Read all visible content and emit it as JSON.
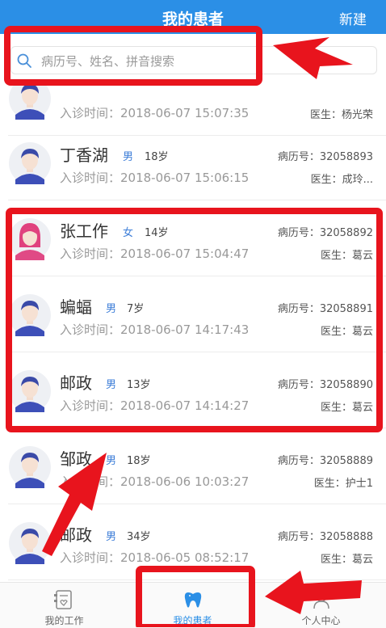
{
  "header": {
    "title": "我的患者",
    "new_label": "新建"
  },
  "search": {
    "placeholder": "病历号、姓名、拼音搜索"
  },
  "patients": [
    {
      "name": "",
      "gender": "",
      "age": "",
      "visit": "入诊时间：2018-06-07 15:07:35",
      "record": "",
      "doctor": "医生：杨光荣",
      "avatar": "male"
    },
    {
      "name": "丁香湖",
      "gender": "男",
      "age": "18岁",
      "visit": "入诊时间：2018-06-07 15:06:15",
      "record": "病历号：32058893",
      "doctor": "医生：成玲...",
      "avatar": "male"
    },
    {
      "name": "张工作",
      "gender": "女",
      "age": "14岁",
      "visit": "入诊时间：2018-06-07 15:04:47",
      "record": "病历号：32058892",
      "doctor": "医生：葛云",
      "avatar": "female"
    },
    {
      "name": "蝙蝠",
      "gender": "男",
      "age": "7岁",
      "visit": "入诊时间：2018-06-07 14:17:43",
      "record": "病历号：32058891",
      "doctor": "医生：葛云",
      "avatar": "male"
    },
    {
      "name": "邮政",
      "gender": "男",
      "age": "13岁",
      "visit": "入诊时间：2018-06-07 14:14:27",
      "record": "病历号：32058890",
      "doctor": "医生：葛云",
      "avatar": "male"
    },
    {
      "name": "邹政",
      "gender": "男",
      "age": "18岁",
      "visit": "入诊时间：2018-06-06 10:03:27",
      "record": "病历号：32058889",
      "doctor": "医生：护士1",
      "avatar": "male"
    },
    {
      "name": "邮政",
      "gender": "男",
      "age": "34岁",
      "visit": "入诊时间：2018-06-05 08:52:17",
      "record": "病历号：32058888",
      "doctor": "医生：葛云",
      "avatar": "male"
    }
  ],
  "tabs": [
    {
      "label": "我的工作",
      "icon": "work-icon",
      "active": false
    },
    {
      "label": "我的患者",
      "icon": "patient-icon",
      "active": true
    },
    {
      "label": "个人中心",
      "icon": "profile-icon",
      "active": false
    }
  ],
  "colors": {
    "primary": "#2b8fe6",
    "annotation": "#e8141d",
    "gender": "#3d7ed8"
  }
}
